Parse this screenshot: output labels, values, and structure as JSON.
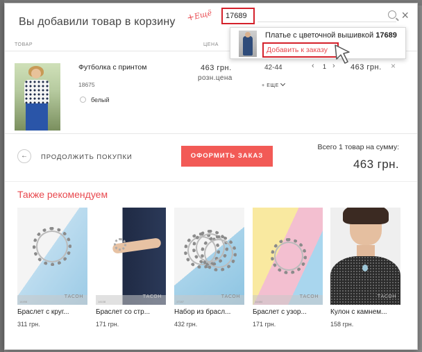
{
  "modal": {
    "title": "Вы добавили товар в корзину",
    "close_glyph": "×"
  },
  "search": {
    "tag_plus": "+",
    "tag_text": "Ещё",
    "value": "17689",
    "icon": "search-icon"
  },
  "table": {
    "headers": [
      "ТОВАР",
      "ЦЕНА"
    ],
    "item": {
      "name": "Футболка с принтом",
      "code": "18675",
      "color": "белый",
      "price": "463 грн.",
      "price_type": "розн.цена",
      "size": "42-44",
      "more_label": "+ ЕЩЕ",
      "qty_minus": "‹",
      "qty": "1",
      "qty_plus": "›",
      "line_total": "463 грн.",
      "remove_glyph": "×"
    }
  },
  "suggestion": {
    "name": "Платье с цветочной вышивкой",
    "code": "17689",
    "action": "Добавить к заказу"
  },
  "footer": {
    "continue_glyph": "←",
    "continue_label": "ПРОДОЛЖИТЬ ПОКУПКИ",
    "checkout_label": "ОФОРМИТЬ ЗАКАЗ",
    "total_label": "Всего 1 товар на сумму:",
    "total_sum": "463 грн."
  },
  "recommendations": {
    "title": "Также рекомендуем",
    "brand": "ТАСОН",
    "items": [
      {
        "name": "Браслет с круг...",
        "price": "311 грн.",
        "code": "14498"
      },
      {
        "name": "Браслет со стр...",
        "price": "171 грн.",
        "code": "14108"
      },
      {
        "name": "Набор из брасл...",
        "price": "432 грн.",
        "code": "17187"
      },
      {
        "name": "Браслет с узор...",
        "price": "171 грн.",
        "code": "14484"
      },
      {
        "name": "Кулон с камнем...",
        "price": "158 грн.",
        "code": ""
      }
    ]
  },
  "colors": {
    "accent": "#f25a56",
    "highlight_border": "#d4202a",
    "reco_title": "#e8494f"
  }
}
